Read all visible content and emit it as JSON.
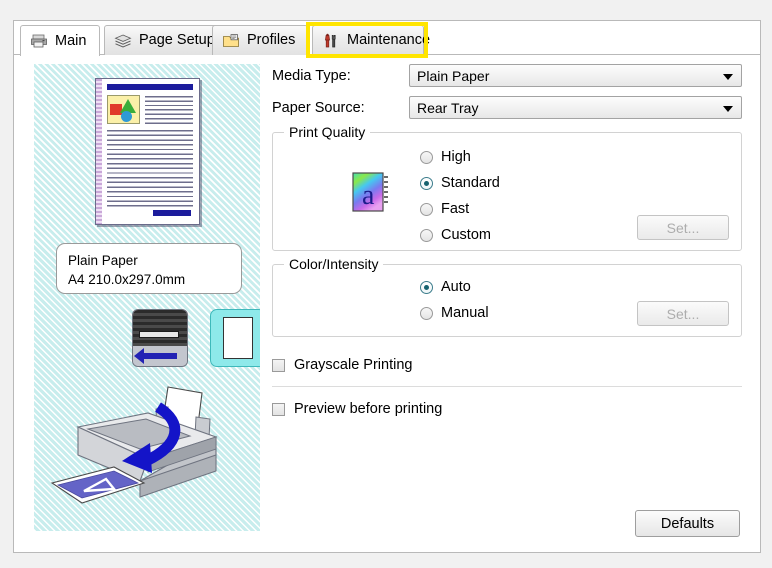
{
  "dialog": {
    "tabs": [
      {
        "label": "Main",
        "icon": "printer-icon",
        "active": true
      },
      {
        "label": "Page Setup",
        "icon": "layers-icon",
        "active": false
      },
      {
        "label": "Profiles",
        "icon": "folder-card-icon",
        "active": false
      },
      {
        "label": "Maintenance",
        "icon": "tools-icon",
        "active": false
      }
    ],
    "annotation": {
      "target": "Maintenance",
      "color": "#ffe500"
    }
  },
  "preview": {
    "paper_name": "Plain Paper",
    "paper_size": "A4 210.0x297.0mm",
    "feeder_icon": "rear-tray-feed-icon",
    "page_icon": "paper-sheet-icon",
    "printer_illustration": "printer-paper-path-illustration"
  },
  "main": {
    "media_type": {
      "label": "Media Type:",
      "value": "Plain Paper"
    },
    "paper_source": {
      "label": "Paper Source:",
      "value": "Rear Tray"
    },
    "print_quality": {
      "title": "Print Quality",
      "icon": "quality-page-a-icon",
      "options": [
        {
          "label": "High",
          "selected": false
        },
        {
          "label": "Standard",
          "selected": true
        },
        {
          "label": "Fast",
          "selected": false
        },
        {
          "label": "Custom",
          "selected": false
        }
      ],
      "set_button": {
        "label": "Set...",
        "enabled": false
      }
    },
    "color_intensity": {
      "title": "Color/Intensity",
      "options": [
        {
          "label": "Auto",
          "selected": true
        },
        {
          "label": "Manual",
          "selected": false
        }
      ],
      "set_button": {
        "label": "Set...",
        "enabled": false
      }
    },
    "grayscale_printing": {
      "label": "Grayscale Printing",
      "checked": false
    },
    "preview_before_printing": {
      "label": "Preview before printing",
      "accel": "g",
      "checked": false
    }
  },
  "footer": {
    "defaults_button": "Defaults"
  },
  "colors": {
    "accent_radio": "#16626f",
    "annotation": "#ffe500",
    "preview_bg": "#d6f2f2",
    "doc_bar": "#1c1c9c",
    "arrow_blue": "#2323b4"
  }
}
